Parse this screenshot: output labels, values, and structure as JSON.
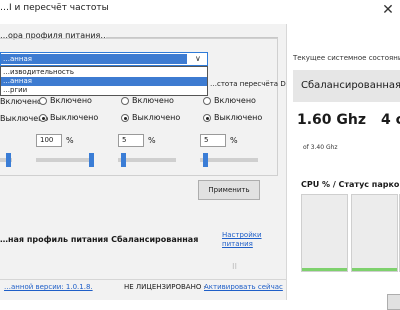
{
  "window": {
    "title": "…I и пересчёт частоты",
    "close_icon": "close-icon"
  },
  "profile_section": {
    "label": "…ора профиля питания…",
    "dropdown_value": "…анная",
    "options": [
      "…изводительность",
      "…анная",
      "…ргии"
    ],
    "selected_index": 1,
    "column_header_dc": "…стота пересчёта DC"
  },
  "controls": [
    {
      "on_label": "Включено",
      "off_label": "Выключено",
      "value": "",
      "slider": 0.0
    },
    {
      "on_label": "Включено",
      "off_label": "Выключено",
      "value": "100",
      "unit": "%",
      "slider": 1.0
    },
    {
      "on_label": "Включено",
      "off_label": "Выключено",
      "value": "5",
      "unit": "%",
      "slider": 0.05
    },
    {
      "on_label": "Включено",
      "off_label": "Выключено",
      "value": "5",
      "unit": "%",
      "slider": 0.05
    }
  ],
  "apply_label": "Применить",
  "status": {
    "active_profile_text": "…ная профиль питания Сбалансированная",
    "settings_link": "Настройки питания"
  },
  "footer": {
    "version_text": "…анной версии: 1.0.1.8.",
    "license_text": "НЕ ЛИЦЕНЗИРОВАНО -",
    "activate_link": "Активировать сейчас"
  },
  "current_state": {
    "title": "Текущее системное состояние",
    "profile": "Сбалансированная",
    "frequency": "1.60 Ghz",
    "cores": "4 c",
    "of_max": "of 3.40 Ghz",
    "cpu_label": "CPU % / Статус парковки",
    "cpu_bars": [
      0.0,
      0.0,
      0.0
    ],
    "bar_color": "#7ed16d"
  }
}
